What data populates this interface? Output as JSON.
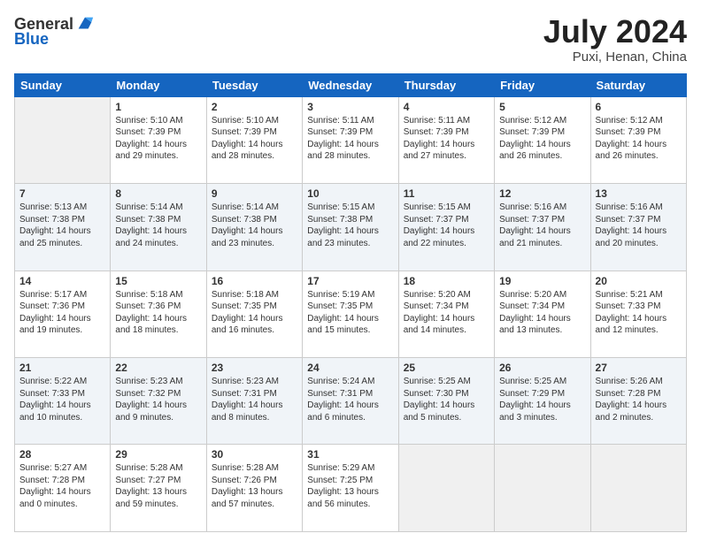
{
  "header": {
    "logo_general": "General",
    "logo_blue": "Blue",
    "month_year": "July 2024",
    "location": "Puxi, Henan, China"
  },
  "days_of_week": [
    "Sunday",
    "Monday",
    "Tuesday",
    "Wednesday",
    "Thursday",
    "Friday",
    "Saturday"
  ],
  "weeks": [
    [
      {
        "day": "",
        "info": ""
      },
      {
        "day": "1",
        "info": "Sunrise: 5:10 AM\nSunset: 7:39 PM\nDaylight: 14 hours\nand 29 minutes."
      },
      {
        "day": "2",
        "info": "Sunrise: 5:10 AM\nSunset: 7:39 PM\nDaylight: 14 hours\nand 28 minutes."
      },
      {
        "day": "3",
        "info": "Sunrise: 5:11 AM\nSunset: 7:39 PM\nDaylight: 14 hours\nand 28 minutes."
      },
      {
        "day": "4",
        "info": "Sunrise: 5:11 AM\nSunset: 7:39 PM\nDaylight: 14 hours\nand 27 minutes."
      },
      {
        "day": "5",
        "info": "Sunrise: 5:12 AM\nSunset: 7:39 PM\nDaylight: 14 hours\nand 26 minutes."
      },
      {
        "day": "6",
        "info": "Sunrise: 5:12 AM\nSunset: 7:39 PM\nDaylight: 14 hours\nand 26 minutes."
      }
    ],
    [
      {
        "day": "7",
        "info": "Sunrise: 5:13 AM\nSunset: 7:38 PM\nDaylight: 14 hours\nand 25 minutes."
      },
      {
        "day": "8",
        "info": "Sunrise: 5:14 AM\nSunset: 7:38 PM\nDaylight: 14 hours\nand 24 minutes."
      },
      {
        "day": "9",
        "info": "Sunrise: 5:14 AM\nSunset: 7:38 PM\nDaylight: 14 hours\nand 23 minutes."
      },
      {
        "day": "10",
        "info": "Sunrise: 5:15 AM\nSunset: 7:38 PM\nDaylight: 14 hours\nand 23 minutes."
      },
      {
        "day": "11",
        "info": "Sunrise: 5:15 AM\nSunset: 7:37 PM\nDaylight: 14 hours\nand 22 minutes."
      },
      {
        "day": "12",
        "info": "Sunrise: 5:16 AM\nSunset: 7:37 PM\nDaylight: 14 hours\nand 21 minutes."
      },
      {
        "day": "13",
        "info": "Sunrise: 5:16 AM\nSunset: 7:37 PM\nDaylight: 14 hours\nand 20 minutes."
      }
    ],
    [
      {
        "day": "14",
        "info": "Sunrise: 5:17 AM\nSunset: 7:36 PM\nDaylight: 14 hours\nand 19 minutes."
      },
      {
        "day": "15",
        "info": "Sunrise: 5:18 AM\nSunset: 7:36 PM\nDaylight: 14 hours\nand 18 minutes."
      },
      {
        "day": "16",
        "info": "Sunrise: 5:18 AM\nSunset: 7:35 PM\nDaylight: 14 hours\nand 16 minutes."
      },
      {
        "day": "17",
        "info": "Sunrise: 5:19 AM\nSunset: 7:35 PM\nDaylight: 14 hours\nand 15 minutes."
      },
      {
        "day": "18",
        "info": "Sunrise: 5:20 AM\nSunset: 7:34 PM\nDaylight: 14 hours\nand 14 minutes."
      },
      {
        "day": "19",
        "info": "Sunrise: 5:20 AM\nSunset: 7:34 PM\nDaylight: 14 hours\nand 13 minutes."
      },
      {
        "day": "20",
        "info": "Sunrise: 5:21 AM\nSunset: 7:33 PM\nDaylight: 14 hours\nand 12 minutes."
      }
    ],
    [
      {
        "day": "21",
        "info": "Sunrise: 5:22 AM\nSunset: 7:33 PM\nDaylight: 14 hours\nand 10 minutes."
      },
      {
        "day": "22",
        "info": "Sunrise: 5:23 AM\nSunset: 7:32 PM\nDaylight: 14 hours\nand 9 minutes."
      },
      {
        "day": "23",
        "info": "Sunrise: 5:23 AM\nSunset: 7:31 PM\nDaylight: 14 hours\nand 8 minutes."
      },
      {
        "day": "24",
        "info": "Sunrise: 5:24 AM\nSunset: 7:31 PM\nDaylight: 14 hours\nand 6 minutes."
      },
      {
        "day": "25",
        "info": "Sunrise: 5:25 AM\nSunset: 7:30 PM\nDaylight: 14 hours\nand 5 minutes."
      },
      {
        "day": "26",
        "info": "Sunrise: 5:25 AM\nSunset: 7:29 PM\nDaylight: 14 hours\nand 3 minutes."
      },
      {
        "day": "27",
        "info": "Sunrise: 5:26 AM\nSunset: 7:28 PM\nDaylight: 14 hours\nand 2 minutes."
      }
    ],
    [
      {
        "day": "28",
        "info": "Sunrise: 5:27 AM\nSunset: 7:28 PM\nDaylight: 14 hours\nand 0 minutes."
      },
      {
        "day": "29",
        "info": "Sunrise: 5:28 AM\nSunset: 7:27 PM\nDaylight: 13 hours\nand 59 minutes."
      },
      {
        "day": "30",
        "info": "Sunrise: 5:28 AM\nSunset: 7:26 PM\nDaylight: 13 hours\nand 57 minutes."
      },
      {
        "day": "31",
        "info": "Sunrise: 5:29 AM\nSunset: 7:25 PM\nDaylight: 13 hours\nand 56 minutes."
      },
      {
        "day": "",
        "info": ""
      },
      {
        "day": "",
        "info": ""
      },
      {
        "day": "",
        "info": ""
      }
    ]
  ]
}
